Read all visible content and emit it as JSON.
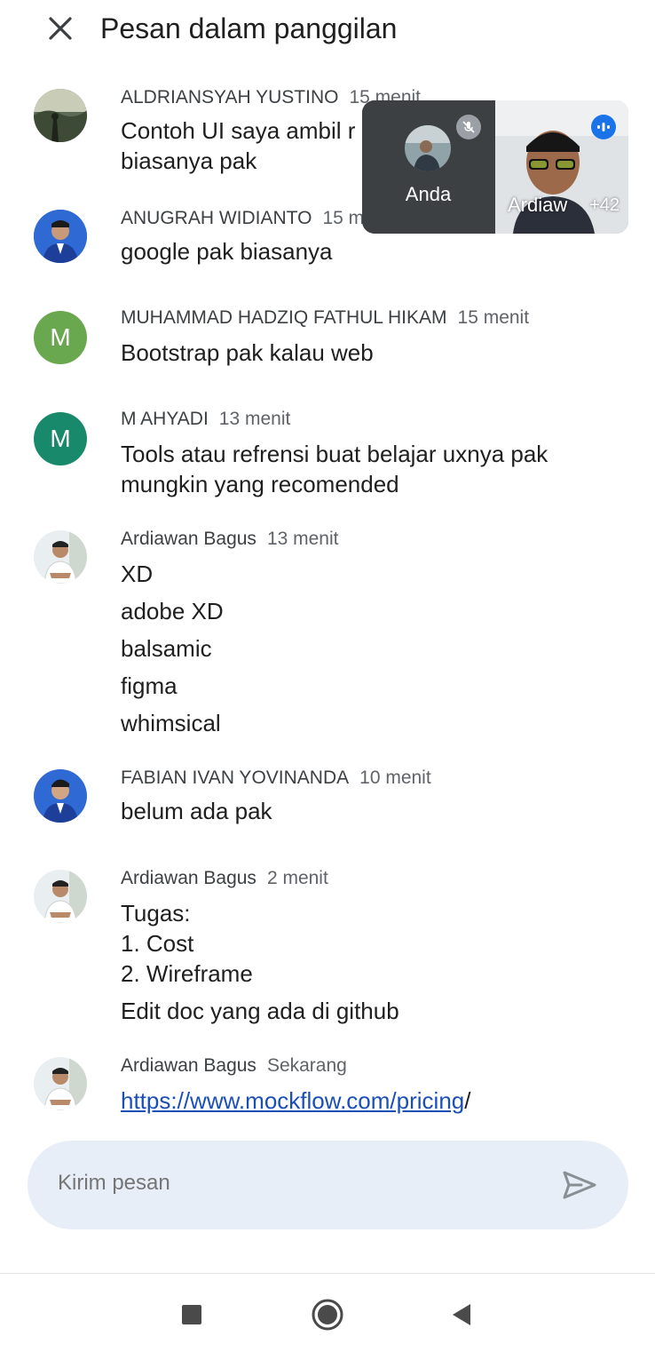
{
  "header": {
    "title": "Pesan dalam panggilan",
    "close_icon": "close-icon"
  },
  "messages": [
    {
      "sender": "ALDRIANSYAH YUSTINO",
      "time": "15 menit",
      "avatar": "photo-landscape",
      "lines": [
        "Contoh UI saya ambil r",
        "biasanya pak"
      ]
    },
    {
      "sender": "ANUGRAH WIDIANTO",
      "time": "15 m",
      "avatar": "photo-person",
      "lines": [
        "google pak biasanya"
      ]
    },
    {
      "sender": "MUHAMMAD HADZIQ FATHUL HIKAM",
      "time": "15 menit",
      "avatar_letter": "M",
      "avatar_color": "#6aa84f",
      "lines": [
        "Bootstrap pak kalau web"
      ]
    },
    {
      "sender": "M AHYADI",
      "time": "13 menit",
      "avatar_letter": "M",
      "avatar_color": "#188a6b",
      "lines": [
        "Tools atau refrensi buat belajar uxnya pak",
        "mungkin yang recomended"
      ]
    },
    {
      "sender": "Ardiawan Bagus",
      "time": "13 menit",
      "avatar": "photo-person",
      "lines": [
        "XD",
        "adobe XD",
        "balsamic",
        "figma",
        "whimsical"
      ]
    },
    {
      "sender": "FABIAN IVAN YOVINANDA",
      "time": "10 menit",
      "avatar": "photo-person",
      "lines": [
        "belum ada pak"
      ]
    },
    {
      "sender": "Ardiawan Bagus",
      "time": "2 menit",
      "avatar": "photo-person",
      "lines": [
        "Tugas:",
        "1. Cost",
        "2. Wireframe",
        "Edit doc yang ada di github"
      ]
    },
    {
      "sender": "Ardiawan Bagus",
      "time": "Sekarang",
      "avatar": "photo-person",
      "link": "https://www.mockflow.com/pricing",
      "link_suffix": "/"
    }
  ],
  "pip": {
    "self_name": "Anda",
    "remote_name": "Ardiaw",
    "participants_extra": "+42",
    "self_status": "mic-off-icon",
    "remote_status": "speaking-icon"
  },
  "composer": {
    "placeholder": "Kirim pesan",
    "send_icon": "send-icon"
  },
  "navbar": {
    "recents_icon": "recents-icon",
    "home_icon": "home-icon",
    "back_icon": "back-icon"
  },
  "colors": {
    "accent": "#1a73e8",
    "link": "#1a4fb8",
    "composer_bg": "#e8eef8",
    "pip_bg": "#3c4043"
  }
}
